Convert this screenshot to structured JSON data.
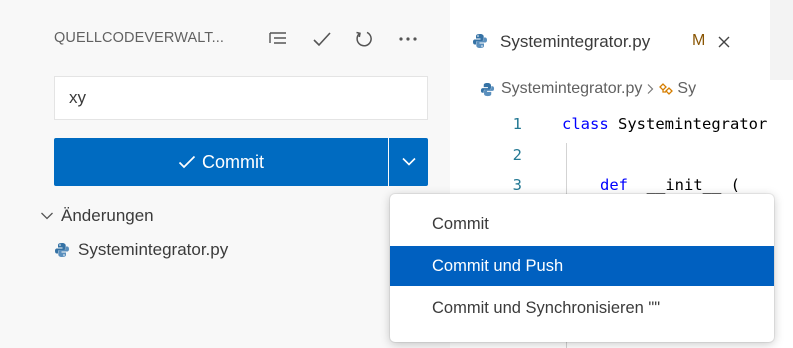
{
  "scm": {
    "title": "QUELLCODEVERWALT...",
    "actions": [
      "view-as-tree-icon",
      "checkmark-icon",
      "refresh-icon",
      "more-actions-icon"
    ],
    "message_value": "xy",
    "commit_label": "Commit",
    "changes_label": "Änderungen",
    "files": [
      {
        "name": "Systemintegrator.py"
      }
    ]
  },
  "editor": {
    "tab": {
      "label": "Systemintegrator.py",
      "modified": "M",
      "close": "×"
    },
    "breadcrumbs": {
      "file": "Systemintegrator.py",
      "symbol": "Sy"
    },
    "lines": [
      {
        "num": "1",
        "keyword": "class",
        "rest": " Systemintegrator"
      },
      {
        "num": "2",
        "keyword": "",
        "rest": ""
      },
      {
        "num": "3",
        "keyword": "def",
        "rest": "  __init__ ("
      }
    ]
  },
  "menu": {
    "items": [
      {
        "label": "Commit"
      },
      {
        "label": "Commit und Push"
      },
      {
        "label": "Commit und Synchronisieren \"\""
      }
    ],
    "active_index": 1
  },
  "colors": {
    "accent": "#006bc1",
    "menu_selection": "#0060c0",
    "modified": "#895503",
    "keyword": "#0000ff",
    "line_number": "#237893"
  }
}
